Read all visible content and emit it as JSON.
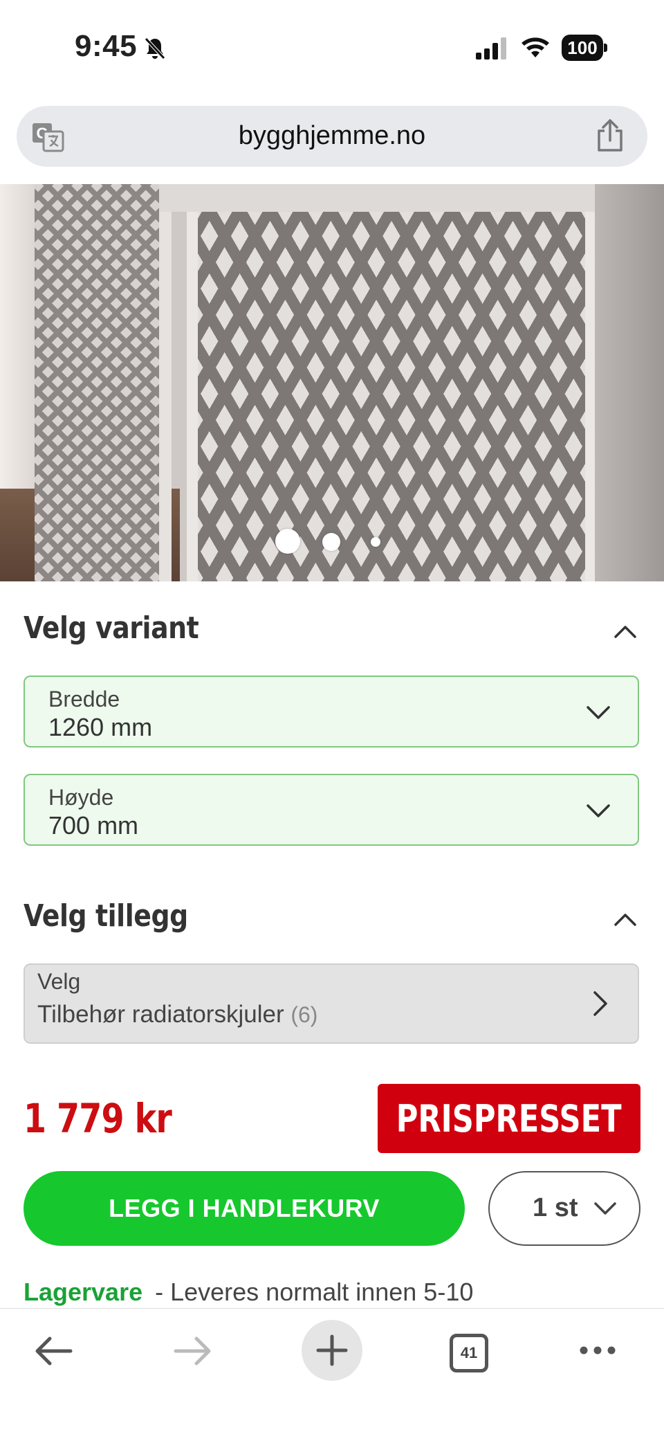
{
  "status_bar": {
    "time": "9:45",
    "battery": "100"
  },
  "browser": {
    "domain": "bygghjemme.no",
    "tab_count": "41"
  },
  "gallery": {
    "total_images": 3,
    "active_index": 1
  },
  "variant": {
    "title": "Velg variant",
    "width": {
      "label": "Bredde",
      "value": "1260 mm"
    },
    "height": {
      "label": "Høyde",
      "value": "700 mm"
    }
  },
  "addon": {
    "title": "Velg tillegg",
    "label": "Velg",
    "value": "Tilbehør radiatorskjuler",
    "count": "(6)"
  },
  "price": {
    "amount": "1 779 kr",
    "badge": "PRISPRESSET"
  },
  "cart": {
    "button_label": "LEGG I HANDLEKURV",
    "quantity": "1 st"
  },
  "stock": {
    "status": "Lagervare",
    "delivery": "- Leveres normalt innen 5-10"
  },
  "colors": {
    "accent_green": "#16c82d",
    "price_red": "#cc0d12",
    "badge_red": "#d1000f",
    "stock_green": "#1aa236"
  }
}
